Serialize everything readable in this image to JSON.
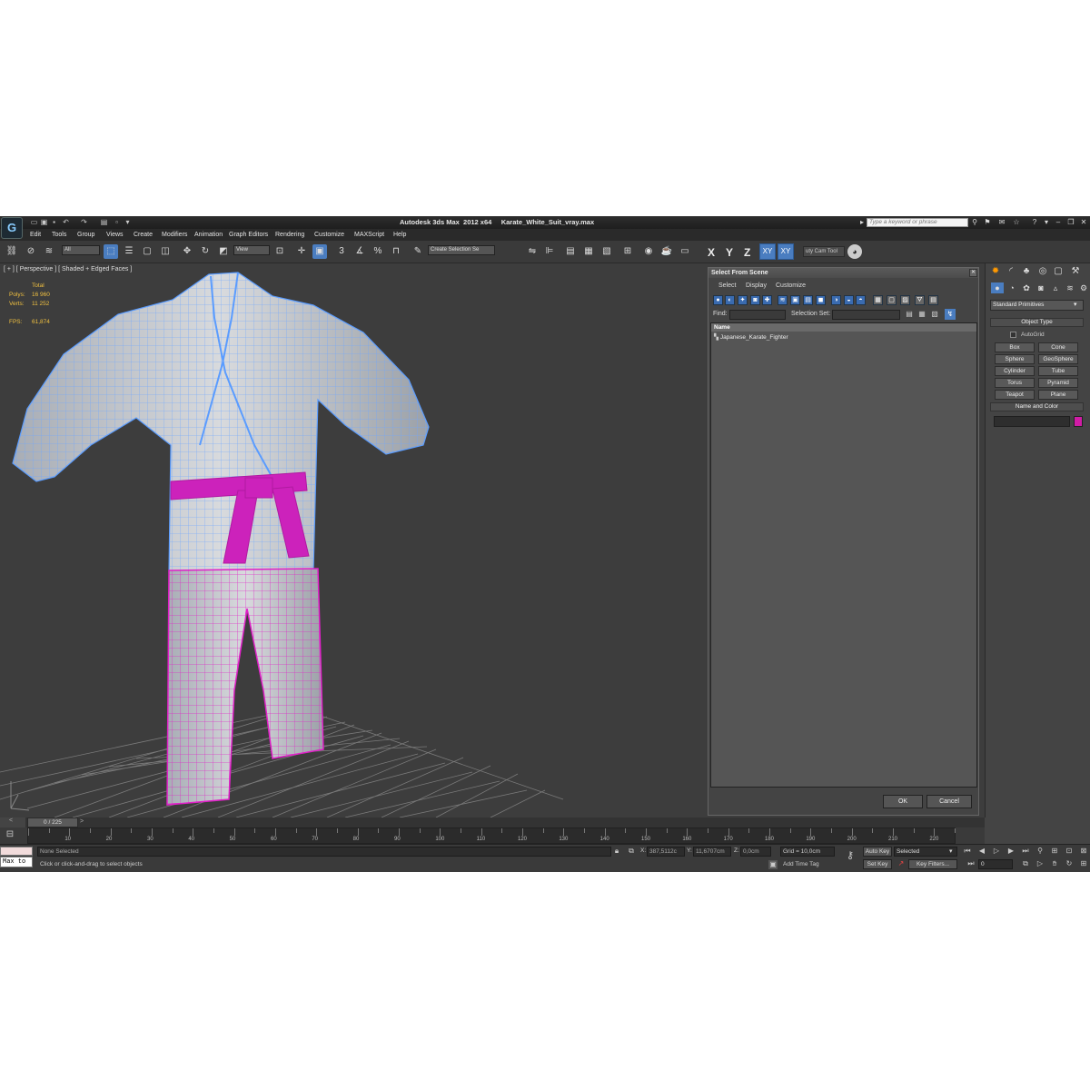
{
  "titlebar": {
    "title": "Autodesk 3ds Max  2012 x64     Karate_White_Suit_vray.max",
    "logo_icon": "3ds-max-logo-icon",
    "search_placeholder": "Type a keyword or phrase"
  },
  "menu": [
    "Edit",
    "Tools",
    "Group",
    "Views",
    "Create",
    "Modifiers",
    "Animation",
    "Graph Editors",
    "Rendering",
    "Customize",
    "MAXScript",
    "Help"
  ],
  "toolbar": {
    "filter": "All",
    "ref_coord": "View",
    "selection_set": "Create Selection Se",
    "axes": [
      "X",
      "Y",
      "Z"
    ],
    "axis_btn_1": "XY",
    "axis_btn_2": "XY",
    "cam_tool": "uty Cam Tool"
  },
  "viewport": {
    "label": "[ + ] [ Perspective ] [ Shaded + Edged Faces ]",
    "stats": {
      "total_label": "Total",
      "polys_label": "Polys:",
      "polys": "16 960",
      "verts_label": "Verts:",
      "verts": "11 252",
      "fps_label": "FPS:",
      "fps": "61,874"
    }
  },
  "dialog": {
    "title": "Select From Scene",
    "menu": [
      "Select",
      "Display",
      "Customize"
    ],
    "find_label": "Find:",
    "selection_set_label": "Selection Set:",
    "list_header": "Name",
    "items": [
      "Japanese_Karate_Fighter"
    ],
    "ok": "OK",
    "cancel": "Cancel"
  },
  "command_panel": {
    "category": "Standard Primitives",
    "object_type_header": "Object Type",
    "autogrid": "AutoGrid",
    "buttons": [
      "Box",
      "Cone",
      "Sphere",
      "GeoSphere",
      "Cylinder",
      "Tube",
      "Torus",
      "Pyramid",
      "Teapot",
      "Plane"
    ],
    "name_color_header": "Name and Color",
    "object_color": "#d11ca6"
  },
  "timeline": {
    "frame": "0 / 225",
    "ticks": [
      "10",
      "20",
      "30",
      "40",
      "50",
      "60",
      "70",
      "80",
      "90",
      "100",
      "110",
      "120",
      "130",
      "140",
      "150",
      "160",
      "170",
      "180",
      "190",
      "200",
      "210",
      "220"
    ]
  },
  "status": {
    "maxscript": "Max to",
    "selection": "None Selected",
    "prompt": "Click or click-and-drag to select objects",
    "x_label": "X:",
    "x": "387,5112c",
    "y_label": "Y:",
    "y": "11,6707cm",
    "z_label": "Z:",
    "z": "0,0cm",
    "grid": "Grid = 10,0cm",
    "add_time_tag": "Add Time Tag",
    "auto_key": "Auto Key",
    "key_mode": "Selected",
    "set_key": "Set Key",
    "key_filters": "Key Filters...",
    "frame_field": "0"
  },
  "colors": {
    "gi_wireframe": "#5a9cff",
    "belt": "#cc22bb",
    "pants_wire": "#e020c8",
    "highlight": "#4a7dc0"
  }
}
